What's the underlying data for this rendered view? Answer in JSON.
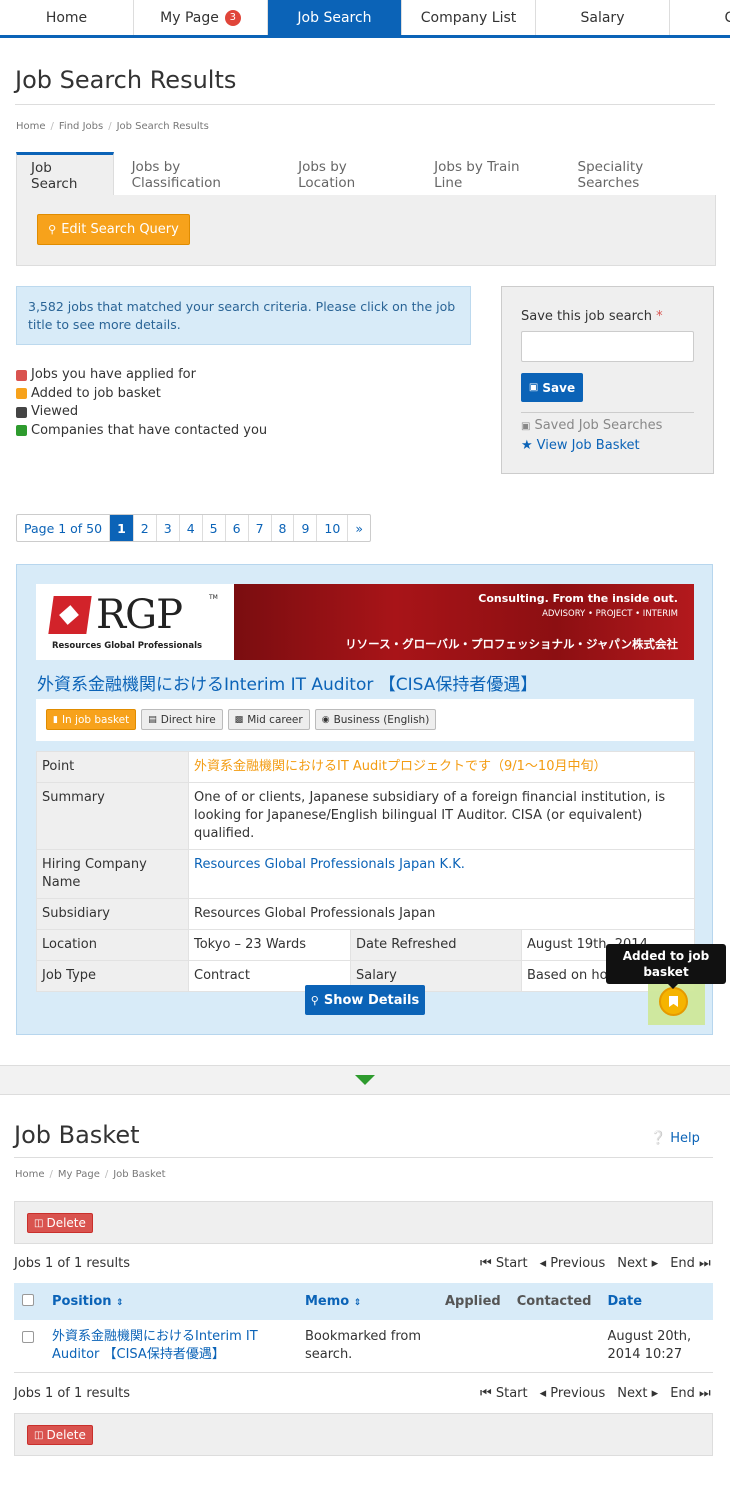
{
  "topnav": [
    "Home",
    "My Page",
    "Job Search",
    "Company List",
    "Salary",
    "Car"
  ],
  "topnav_badge": "3",
  "results": {
    "title": "Job Search Results",
    "breadcrumb": [
      "Home",
      "Find Jobs",
      "Job Search Results"
    ],
    "tabs": [
      "Job Search",
      "Jobs by Classification",
      "Jobs by Location",
      "Jobs by Train Line",
      "Speciality Searches"
    ],
    "edit_button": "Edit Search Query",
    "info": "3,582 jobs that matched your search criteria. Please click on the job title to see more details.",
    "legend": [
      {
        "label": "Jobs you have applied for",
        "color": "#d9534f"
      },
      {
        "label": "Added to job basket",
        "color": "#f7a21b"
      },
      {
        "label": "Viewed",
        "color": "#444444"
      },
      {
        "label": "Companies that have contacted you",
        "color": "#2e9b2e"
      }
    ],
    "save_label": "Save this job search",
    "required_mark": "*",
    "save_button": "Save",
    "saved_searches": "Saved Job Searches",
    "view_basket": "View Job Basket",
    "pager": [
      "Page 1 of 50",
      "1",
      "2",
      "3",
      "4",
      "5",
      "6",
      "7",
      "8",
      "9",
      "10",
      "»"
    ]
  },
  "job": {
    "banner": {
      "logo_text": "RGP",
      "logo_tm": "TM",
      "logo_sub": "Resources Global Professionals",
      "tagline": "Consulting. From the inside out.",
      "services": "ADVISORY • PROJECT • INTERIM",
      "company_jp": "リソース・グローバル・プロフェッショナル・ジャパン株式会社"
    },
    "title": "外資系金融機関におけるInterim IT Auditor 【CISA保持者優遇】",
    "tags": [
      "In job basket",
      "Direct hire",
      "Mid career",
      "Business (English)"
    ],
    "point_label": "Point",
    "point": "外資系金融機関におけるIT Auditプロジェクトです（9/1〜10月中旬）",
    "summary_label": "Summary",
    "summary": "One of or clients, Japanese subsidiary of a foreign financial institution, is looking for Japanese/English bilingual IT Auditor. CISA (or equivalent) qualified.",
    "hiring_label": "Hiring Company Name",
    "hiring": "Resources Global Professionals Japan K.K.",
    "subsidiary_label": "Subsidiary",
    "subsidiary": "Resources Global Professionals Japan",
    "location_label": "Location",
    "location": "Tokyo – 23 Wards",
    "refreshed_label": "Date Refreshed",
    "refreshed": "August 19th, 2014",
    "type_label": "Job Type",
    "type": "Contract",
    "salary_label": "Salary",
    "salary": "Based on hourly",
    "show_button": "Show Details",
    "tooltip": "Added to job basket"
  },
  "basket": {
    "title": "Job Basket",
    "help": "Help",
    "breadcrumb": [
      "Home",
      "My Page",
      "Job Basket"
    ],
    "delete_button": "Delete",
    "count": "Jobs 1 of 1 results",
    "nav": [
      "Start",
      "Previous",
      "Next",
      "End"
    ],
    "headers": [
      "Position",
      "Memo",
      "Applied",
      "Contacted",
      "Date"
    ],
    "rows": [
      {
        "position": "外資系金融機関におけるInterim IT Auditor 【CISA保持者優遇】",
        "memo": "Bookmarked from search.",
        "applied": "",
        "contacted": "",
        "date": "August 20th, 2014 10:27"
      }
    ]
  }
}
